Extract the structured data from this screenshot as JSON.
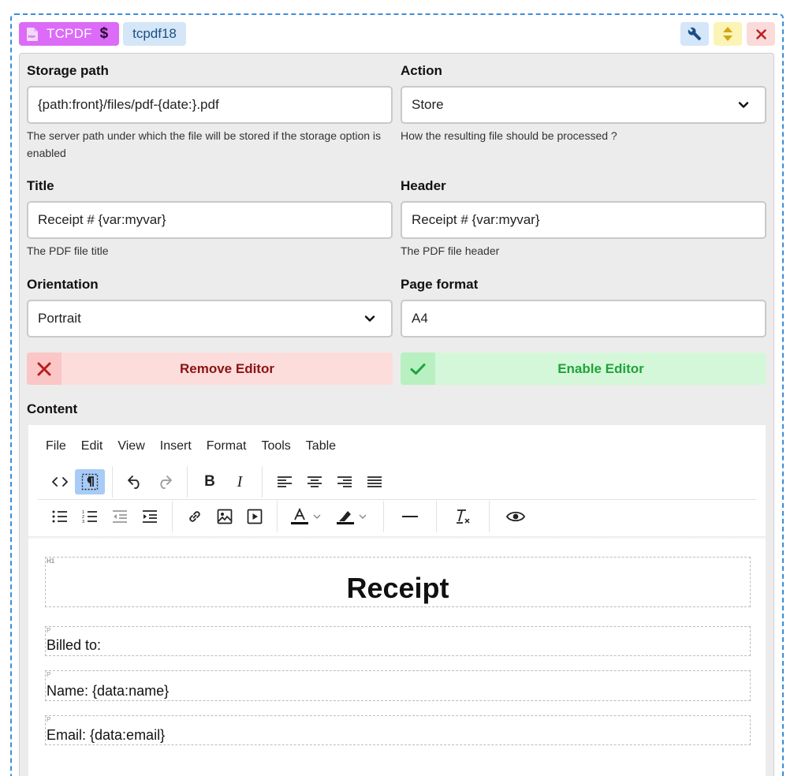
{
  "header": {
    "badge_label": "TCPDF",
    "badge_icon": "dollar-icon",
    "name_label": "tcpdf18",
    "buttons": [
      "wrench-icon",
      "sort-icon",
      "close-icon"
    ],
    "colors": {
      "badge": "#dc6bf7",
      "name": "#d4e6f8"
    }
  },
  "form": {
    "storage_path": {
      "label": "Storage path",
      "value": "{path:front}/files/pdf-{date:}.pdf",
      "help": "The server path under which the file will be stored if the storage option is enabled"
    },
    "action": {
      "label": "Action",
      "value": "Store",
      "help": "How the resulting file should be processed ?"
    },
    "title": {
      "label": "Title",
      "value": "Receipt # {var:myvar}",
      "help": "The PDF file title"
    },
    "header": {
      "label": "Header",
      "value": "Receipt # {var:myvar}",
      "help": "The PDF file header"
    },
    "orientation": {
      "label": "Orientation",
      "value": "Portrait"
    },
    "page_format": {
      "label": "Page format",
      "value": "A4"
    },
    "remove_editor": "Remove Editor",
    "enable_editor": "Enable Editor",
    "content_label": "Content"
  },
  "editor": {
    "menu": [
      "File",
      "Edit",
      "View",
      "Insert",
      "Format",
      "Tools",
      "Table"
    ],
    "toolbar_row1": [
      "source-code-icon",
      "show-blocks-icon",
      "undo-icon",
      "redo-icon",
      "bold-icon",
      "italic-icon",
      "align-left-icon",
      "align-center-icon",
      "align-right-icon",
      "justify-icon"
    ],
    "toolbar_row2": [
      "bullet-list-icon",
      "numbered-list-icon",
      "outdent-icon",
      "indent-icon",
      "link-icon",
      "image-icon",
      "media-icon",
      "text-color-icon",
      "highlight-icon",
      "horizontal-line-icon",
      "clear-format-icon",
      "preview-icon"
    ],
    "content": {
      "heading": "Receipt",
      "heading_tag": "H1",
      "paragraphs": [
        "Billed to:",
        "Name: {data:name}",
        "Email: {data:email}"
      ],
      "paragraph_tag": "P"
    }
  }
}
